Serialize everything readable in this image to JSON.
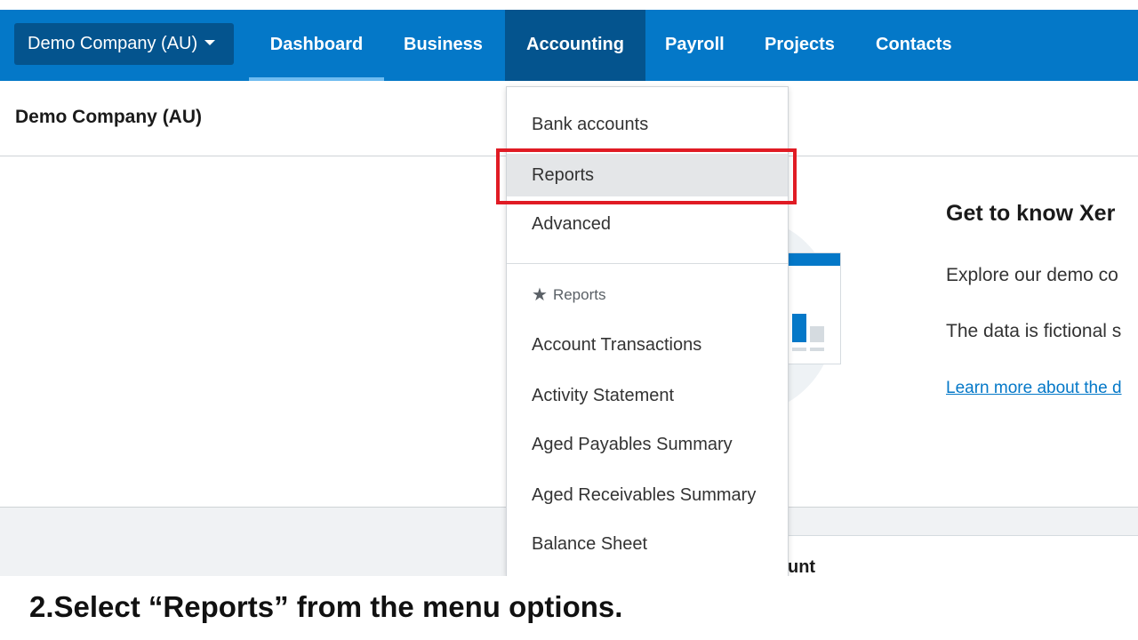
{
  "nav": {
    "org_switcher": "Demo Company (AU)",
    "items": [
      "Dashboard",
      "Business",
      "Accounting",
      "Payroll",
      "Projects",
      "Contacts"
    ],
    "active_item": "Accounting",
    "colors": {
      "bar": "#0478c8",
      "active": "#04548e"
    }
  },
  "page": {
    "title": "Demo Company (AU)"
  },
  "promo": {
    "title": "Get to know Xer",
    "line1": "Explore our demo co",
    "line2": "The data is fictional s",
    "link": "Learn more about the d"
  },
  "footer_card": {
    "text": "unt"
  },
  "dropdown": {
    "items_top": [
      "Bank accounts",
      "Reports",
      "Advanced"
    ],
    "selected": "Reports",
    "group_label": "Reports",
    "group_items": [
      "Account Transactions",
      "Activity Statement",
      "Aged Payables Summary",
      "Aged Receivables Summary",
      "Balance Sheet"
    ]
  },
  "annotation": {
    "highlight_color": "#e01b24",
    "caption": "2.Select “Reports” from the menu options."
  }
}
